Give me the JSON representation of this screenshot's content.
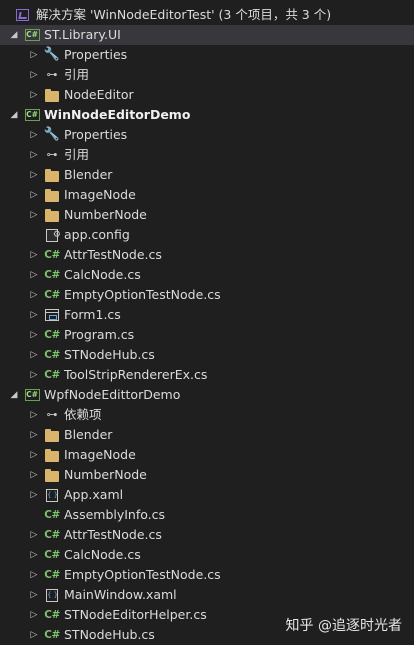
{
  "solution": {
    "title": "解决方案 'WinNodeEditorTest' (3 个项目，共 3 个)"
  },
  "rows": [
    {
      "label": "ST.Library.UI",
      "icon": "csproj-icon",
      "expand": "collapse",
      "indent": 1,
      "bold": false,
      "selected": true
    },
    {
      "label": "Properties",
      "icon": "wrench-icon",
      "expand": "expand",
      "indent": 2
    },
    {
      "label": "引用",
      "icon": "ref-icon",
      "expand": "expand",
      "indent": 2
    },
    {
      "label": "NodeEditor",
      "icon": "folder-icon",
      "expand": "expand",
      "indent": 2
    },
    {
      "label": "WinNodeEditorDemo",
      "icon": "csproj-icon",
      "expand": "collapse",
      "indent": 1,
      "bold": true
    },
    {
      "label": "Properties",
      "icon": "wrench-icon",
      "expand": "expand",
      "indent": 2
    },
    {
      "label": "引用",
      "icon": "ref-icon",
      "expand": "expand",
      "indent": 2
    },
    {
      "label": "Blender",
      "icon": "folder-icon",
      "expand": "expand",
      "indent": 2
    },
    {
      "label": "ImageNode",
      "icon": "folder-icon",
      "expand": "expand",
      "indent": 2
    },
    {
      "label": "NumberNode",
      "icon": "folder-icon",
      "expand": "expand",
      "indent": 2
    },
    {
      "label": "app.config",
      "icon": "config-icon",
      "expand": "none",
      "indent": 2
    },
    {
      "label": "AttrTestNode.cs",
      "icon": "cs-icon",
      "expand": "expand",
      "indent": 2
    },
    {
      "label": "CalcNode.cs",
      "icon": "cs-icon",
      "expand": "expand",
      "indent": 2
    },
    {
      "label": "EmptyOptionTestNode.cs",
      "icon": "cs-icon",
      "expand": "expand",
      "indent": 2
    },
    {
      "label": "Form1.cs",
      "icon": "form-icon",
      "expand": "expand",
      "indent": 2
    },
    {
      "label": "Program.cs",
      "icon": "cs-icon",
      "expand": "expand",
      "indent": 2
    },
    {
      "label": "STNodeHub.cs",
      "icon": "cs-icon",
      "expand": "expand",
      "indent": 2
    },
    {
      "label": "ToolStripRendererEx.cs",
      "icon": "cs-icon",
      "expand": "expand",
      "indent": 2
    },
    {
      "label": "WpfNodeEdittorDemo",
      "icon": "csproj-icon",
      "expand": "collapse",
      "indent": 1
    },
    {
      "label": "依赖项",
      "icon": "ref-icon",
      "expand": "expand",
      "indent": 2
    },
    {
      "label": "Blender",
      "icon": "folder-icon",
      "expand": "expand",
      "indent": 2
    },
    {
      "label": "ImageNode",
      "icon": "folder-icon",
      "expand": "expand",
      "indent": 2
    },
    {
      "label": "NumberNode",
      "icon": "folder-icon",
      "expand": "expand",
      "indent": 2
    },
    {
      "label": "App.xaml",
      "icon": "xaml-icon",
      "expand": "expand",
      "indent": 2
    },
    {
      "label": "AssemblyInfo.cs",
      "icon": "cs-icon",
      "expand": "none",
      "indent": 2
    },
    {
      "label": "AttrTestNode.cs",
      "icon": "cs-icon",
      "expand": "expand",
      "indent": 2
    },
    {
      "label": "CalcNode.cs",
      "icon": "cs-icon",
      "expand": "expand",
      "indent": 2
    },
    {
      "label": "EmptyOptionTestNode.cs",
      "icon": "cs-icon",
      "expand": "expand",
      "indent": 2
    },
    {
      "label": "MainWindow.xaml",
      "icon": "xaml-icon",
      "expand": "expand",
      "indent": 2
    },
    {
      "label": "STNodeEditorHelper.cs",
      "icon": "cs-icon",
      "expand": "expand",
      "indent": 2
    },
    {
      "label": "STNodeHub.cs",
      "icon": "cs-icon",
      "expand": "expand",
      "indent": 2
    }
  ],
  "icon_text": {
    "cs": "C#",
    "csproj": "C#",
    "wrench": "🔧",
    "ref": "⊶",
    "xaml": "{ }"
  },
  "watermark": "知乎 @追逐时光者"
}
